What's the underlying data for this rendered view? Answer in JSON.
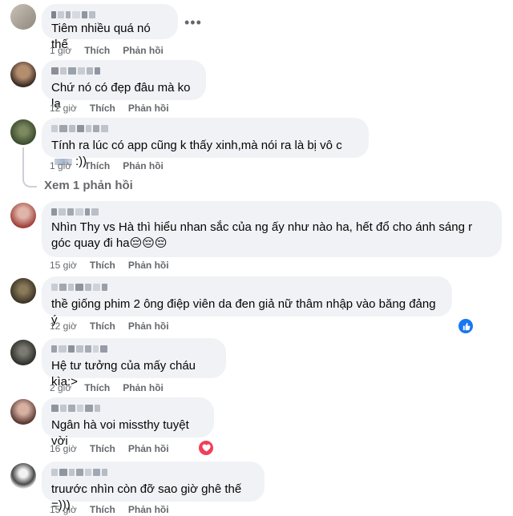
{
  "actions": {
    "like": "Thích",
    "reply": "Phản hồi"
  },
  "comments": [
    {
      "text": "Tiêm nhiều quá nó thế",
      "time": "1 giờ"
    },
    {
      "text": "Chứ nó có đẹp đâu mà ko lạ",
      "time": "12 giờ"
    },
    {
      "text": "Tính ra lúc có app cũng k thấy xinh,mà nói ra là bị vô c",
      "text_tail": ":))",
      "time": "1 giờ",
      "view_replies": "Xem 1 phản hồi"
    },
    {
      "text": "Nhìn Thy vs Hà thì hiểu nhan sắc của ng ấy như nào ha, hết đổ cho ánh sáng r góc quay đi ha😔😔😔",
      "time": "15 giờ"
    },
    {
      "text": "thề giống phim 2 ông điệp viên da đen giả nữ thâm nhập vào băng đảng ý",
      "time": "12 giờ",
      "reaction": "like-reaction-icon"
    },
    {
      "text": "Hệ tư tưởng của mấy cháu kìa:>",
      "time": "2 giờ"
    },
    {
      "text": "Ngân hà voi missthy tuyệt vời",
      "time": "16 giờ",
      "reaction": "love-reaction-icon"
    },
    {
      "text": "truước nhìn còn đỡ sao giờ ghê thế =)))",
      "time": "15 giờ"
    }
  ],
  "colors": {
    "bubble": "#f0f2f5",
    "meta": "#65676b",
    "like_reaction": "#1877f2",
    "love_reaction": "#f33e58"
  }
}
